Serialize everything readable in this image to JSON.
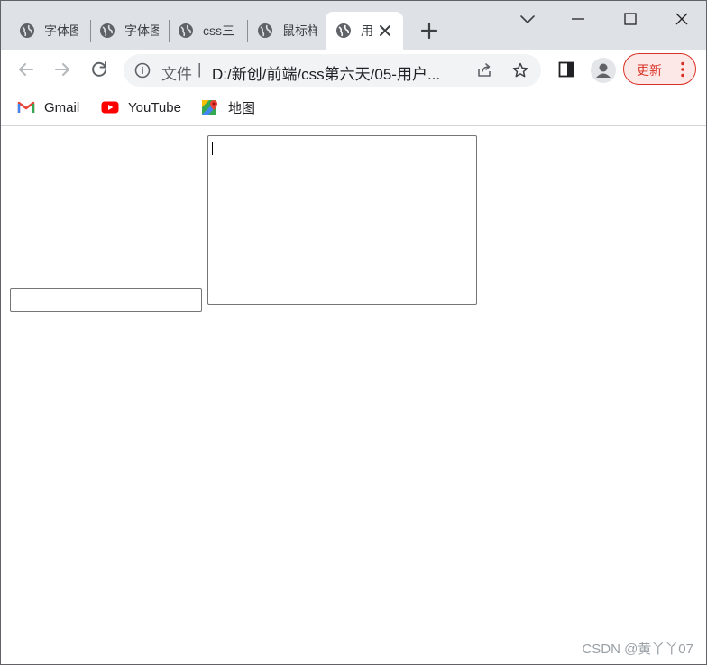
{
  "tabs": [
    {
      "title": "字体图",
      "active": false,
      "icon": "globe-icon"
    },
    {
      "title": "字体图",
      "active": false,
      "icon": "globe-icon"
    },
    {
      "title": "css三",
      "active": false,
      "icon": "globe-icon"
    },
    {
      "title": "鼠标样",
      "active": false,
      "icon": "globe-icon"
    },
    {
      "title": "用",
      "active": true,
      "icon": "globe-icon"
    }
  ],
  "toolbar": {
    "scheme_label": "文件",
    "divider": "|",
    "url": "D:/新创/前端/css第六天/05-用户...",
    "update_label": "更新"
  },
  "bookmarks": [
    {
      "label": "Gmail",
      "icon": "gmail-icon"
    },
    {
      "label": "YouTube",
      "icon": "youtube-icon"
    },
    {
      "label": "地图",
      "icon": "maps-icon"
    }
  ],
  "page": {
    "input_value": "",
    "textarea_value": ""
  },
  "watermark": "CSDN @黄丫丫07",
  "colors": {
    "tabstrip_bg": "#dee1e6",
    "update_red": "#d93025",
    "omnibox_bg": "#f1f3f4"
  }
}
